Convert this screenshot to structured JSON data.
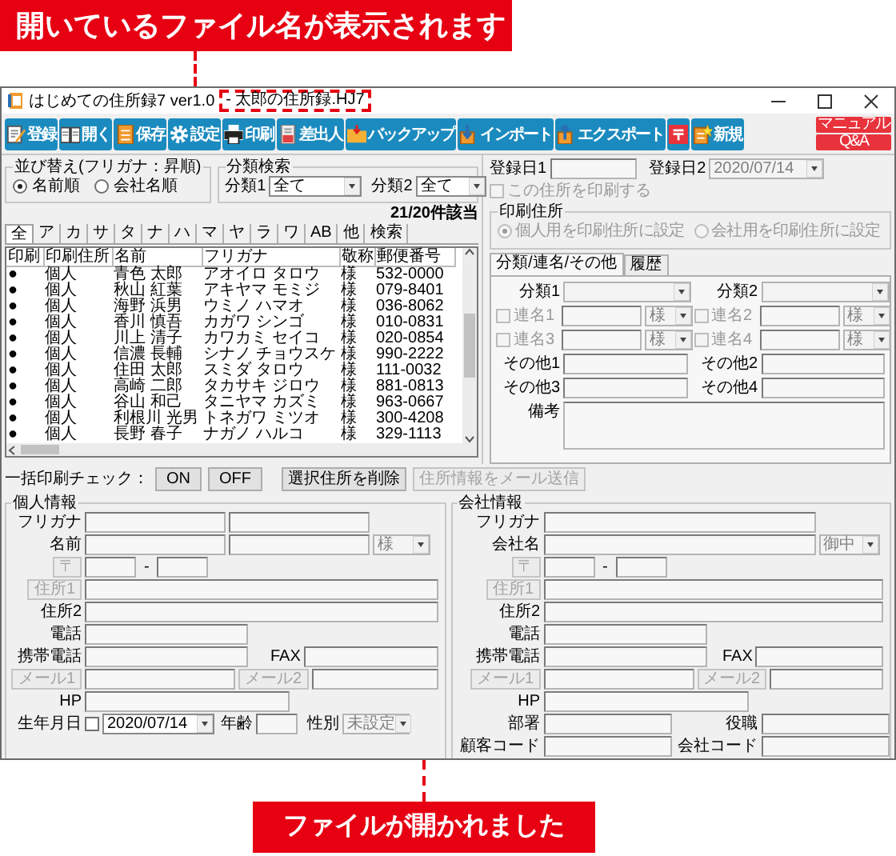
{
  "top_callout": {
    "text": "開いているファイル名が表示されます"
  },
  "window": {
    "title": "はじめての住所録7 ver1.0",
    "file_name": "- 太郎の住所録.HJ7"
  },
  "toolbar": {
    "buttons": [
      {
        "kind": "labeled",
        "label": "登録"
      },
      {
        "kind": "labeled",
        "label": "開く"
      },
      {
        "kind": "labeled",
        "label": "保存"
      },
      {
        "kind": "labeled",
        "label": "設定"
      },
      {
        "kind": "labeled",
        "label": "印刷"
      },
      {
        "kind": "labeled",
        "label": "差出人"
      },
      {
        "kind": "labeled",
        "label": "バックアップ"
      },
      {
        "kind": "labeled",
        "label": "インポート"
      },
      {
        "kind": "labeled",
        "label": "エクスポート"
      },
      {
        "kind": "icon"
      },
      {
        "kind": "labeled",
        "label": "新規"
      }
    ],
    "help": [
      "マニュアル",
      "Q&A"
    ]
  },
  "sort": {
    "title": "並び替え(フリガナ：昇順)",
    "options": [
      {
        "label": "名前順",
        "selected": true
      },
      {
        "label": "会社名順",
        "selected": false
      }
    ]
  },
  "category_search": {
    "title": "分類検索",
    "fields": [
      {
        "label": "分類1",
        "value": "全て"
      },
      {
        "label": "分類2",
        "value": "全て"
      }
    ]
  },
  "result_count": "21/20件該当",
  "index_tabs": [
    {
      "label": "全",
      "selected": true
    },
    {
      "label": "ア",
      "selected": false
    },
    {
      "label": "カ",
      "selected": false
    },
    {
      "label": "サ",
      "selected": false
    },
    {
      "label": "タ",
      "selected": false
    },
    {
      "label": "ナ",
      "selected": false
    },
    {
      "label": "ハ",
      "selected": false
    },
    {
      "label": "マ",
      "selected": false
    },
    {
      "label": "ヤ",
      "selected": false
    },
    {
      "label": "ラ",
      "selected": false
    },
    {
      "label": "ワ",
      "selected": false
    },
    {
      "label": "AB",
      "selected": false
    },
    {
      "label": "他",
      "selected": false
    },
    {
      "label": "検索",
      "selected": false
    }
  ],
  "table": {
    "columns": [
      "印刷",
      "印刷住所",
      "名前",
      "フリガナ",
      "敬称",
      "郵便番号"
    ],
    "rows": [
      {
        "cells": [
          "●",
          "個人",
          "青色 太郎",
          "アオイロ タロウ",
          "様",
          "532-0000"
        ]
      },
      {
        "cells": [
          "●",
          "個人",
          "秋山 紅葉",
          "アキヤマ モミジ",
          "様",
          "079-8401"
        ]
      },
      {
        "cells": [
          "●",
          "個人",
          "海野 浜男",
          "ウミノ ハマオ",
          "様",
          "036-8062"
        ]
      },
      {
        "cells": [
          "●",
          "個人",
          "香川 慎吾",
          "カガワ シンゴ",
          "様",
          "010-0831"
        ]
      },
      {
        "cells": [
          "●",
          "個人",
          "川上 清子",
          "カワカミ セイコ",
          "様",
          "020-0854"
        ]
      },
      {
        "cells": [
          "●",
          "個人",
          "信濃 長輔",
          "シナノ チョウスケ",
          "様",
          "990-2222"
        ]
      },
      {
        "cells": [
          "●",
          "個人",
          "住田 太郎",
          "スミダ タロウ",
          "様",
          "111-0032"
        ]
      },
      {
        "cells": [
          "●",
          "個人",
          "高崎 二郎",
          "タカサキ ジロウ",
          "様",
          "881-0813"
        ]
      },
      {
        "cells": [
          "●",
          "個人",
          "谷山 和己",
          "タニヤマ カズミ",
          "様",
          "963-0667"
        ]
      },
      {
        "cells": [
          "●",
          "個人",
          "利根川 光男",
          "トネガワ ミツオ",
          "様",
          "300-4208"
        ]
      },
      {
        "cells": [
          "●",
          "個人",
          "長野 春子",
          "ナガノ ハルコ",
          "様",
          "329-1113"
        ]
      }
    ]
  },
  "bulk_print": {
    "label": "一括印刷チェック：",
    "buttons": [
      {
        "label": "ON"
      },
      {
        "label": "OFF"
      }
    ]
  },
  "actions": [
    {
      "label": "選択住所を削除",
      "disabled": false
    },
    {
      "label": "住所情報をメール送信",
      "disabled": true
    }
  ],
  "registration": {
    "date1": {
      "label": "登録日1"
    },
    "date2": {
      "label": "登録日2",
      "value": "2020/07/14"
    }
  },
  "print_this": {
    "label": "この住所を印刷する",
    "checked": false,
    "disabled": true
  },
  "print_address": {
    "title": "印刷住所",
    "disabled": true,
    "options": [
      {
        "label": "個人用を印刷住所に設定",
        "selected": true
      },
      {
        "label": "会社用を印刷住所に設定",
        "selected": false
      }
    ]
  },
  "detail_tabs": [
    {
      "label": "分類/連名/その他",
      "selected": true
    },
    {
      "label": "履歴",
      "selected": false
    }
  ],
  "detail": {
    "categories": [
      {
        "label": "分類1"
      },
      {
        "label": "分類2"
      }
    ],
    "joint_names": [
      {
        "label": "連名1",
        "checked": false,
        "disabled": true,
        "honorific": "様"
      },
      {
        "label": "連名2",
        "checked": false,
        "disabled": true,
        "honorific": "様"
      },
      {
        "label": "連名3",
        "checked": false,
        "disabled": true,
        "honorific": "様"
      },
      {
        "label": "連名4",
        "checked": false,
        "disabled": true,
        "honorific": "様"
      }
    ],
    "others": [
      {
        "label": "その他1"
      },
      {
        "label": "その他2"
      },
      {
        "label": "その他3"
      },
      {
        "label": "その他4"
      }
    ],
    "memo": {
      "label": "備考"
    }
  },
  "personal": {
    "title": "個人情報",
    "furigana": {
      "label": "フリガナ"
    },
    "name": {
      "label": "名前",
      "honorific": "様"
    },
    "postal": {
      "button": {
        "label": "〒",
        "disabled": true
      },
      "separator": "-"
    },
    "address1": {
      "button": {
        "label": "住所1",
        "disabled": true
      }
    },
    "address2": {
      "label": "住所2"
    },
    "phone": {
      "label": "電話"
    },
    "mobile": {
      "label": "携帯電話"
    },
    "fax": {
      "label": "FAX"
    },
    "mail1": {
      "button": {
        "label": "メール1",
        "disabled": true
      }
    },
    "mail2": {
      "button": {
        "label": "メール2",
        "disabled": true
      }
    },
    "hp": {
      "label": "HP"
    },
    "birthday": {
      "label": "生年月日",
      "checked": false,
      "value": "2020/07/14"
    },
    "age": {
      "label": "年齢"
    },
    "gender": {
      "label": "性別",
      "value": "未設定"
    }
  },
  "company": {
    "title": "会社情報",
    "furigana": {
      "label": "フリガナ"
    },
    "name": {
      "label": "会社名",
      "honorific": "御中"
    },
    "postal": {
      "button": {
        "label": "〒",
        "disabled": true
      },
      "separator": "-"
    },
    "address1": {
      "button": {
        "label": "住所1",
        "disabled": true
      }
    },
    "address2": {
      "label": "住所2"
    },
    "phone": {
      "label": "電話"
    },
    "mobile": {
      "label": "携帯電話"
    },
    "fax": {
      "label": "FAX"
    },
    "mail1": {
      "button": {
        "label": "メール1",
        "disabled": true
      }
    },
    "mail2": {
      "button": {
        "label": "メール2",
        "disabled": true
      }
    },
    "hp": {
      "label": "HP"
    },
    "department": {
      "label": "部署"
    },
    "position": {
      "label": "役職"
    },
    "customer_code": {
      "label": "顧客コード"
    },
    "company_code": {
      "label": "会社コード"
    }
  },
  "bottom_callout": {
    "text": "ファイルが開かれました"
  }
}
